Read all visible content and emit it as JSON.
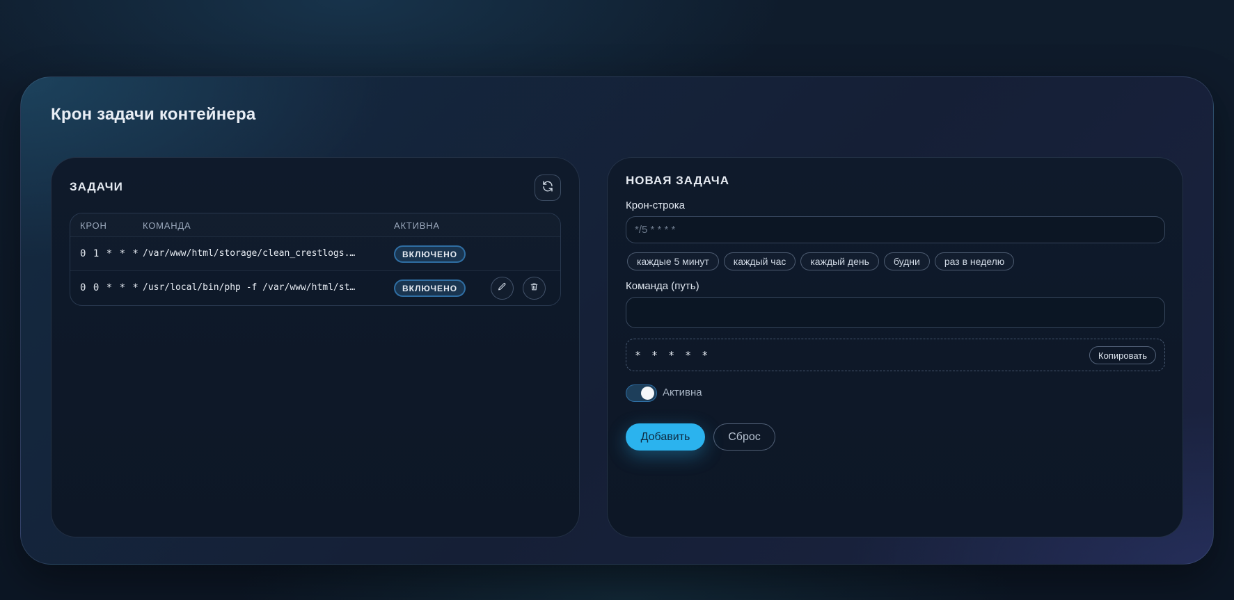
{
  "page": {
    "title": "Крон задачи контейнера"
  },
  "tasks_panel": {
    "heading": "ЗАДАЧИ",
    "refresh_icon": "refresh-icon",
    "columns": [
      "КРОН",
      "КОМАНДА",
      "АКТИВНА"
    ],
    "rows": [
      {
        "cron": "0 1 * * *",
        "command": "/var/www/html/storage/clean_crestlogs.sh",
        "status": "ВКЛЮЧЕНО"
      },
      {
        "cron": "0 0 * * *",
        "command": "/usr/local/bin/php -f /var/www/html/storage/cron.php",
        "status": "ВКЛЮЧЕНО",
        "actions": [
          "pencil-icon",
          "trash-icon"
        ]
      }
    ]
  },
  "new_task": {
    "heading": "НОВАЯ ЗАДАЧА",
    "cron_label": "Крон-строка",
    "cron_placeholder": "*/5 * * * *",
    "cron_value": "",
    "presets": [
      "каждые 5 минут",
      "каждый час",
      "каждый день",
      "будни",
      "раз в неделю"
    ],
    "command_label": "Команда (путь)",
    "command_value": "",
    "preview": "* * * * *",
    "copy_label": "Копировать",
    "active_label": "Активна",
    "active": true,
    "add_label": "Добавить",
    "reset_label": "Сброс"
  },
  "colors": {
    "accent": "#2bb3ee",
    "badge_border": "#2f6ea3",
    "background": "#0c1624"
  }
}
